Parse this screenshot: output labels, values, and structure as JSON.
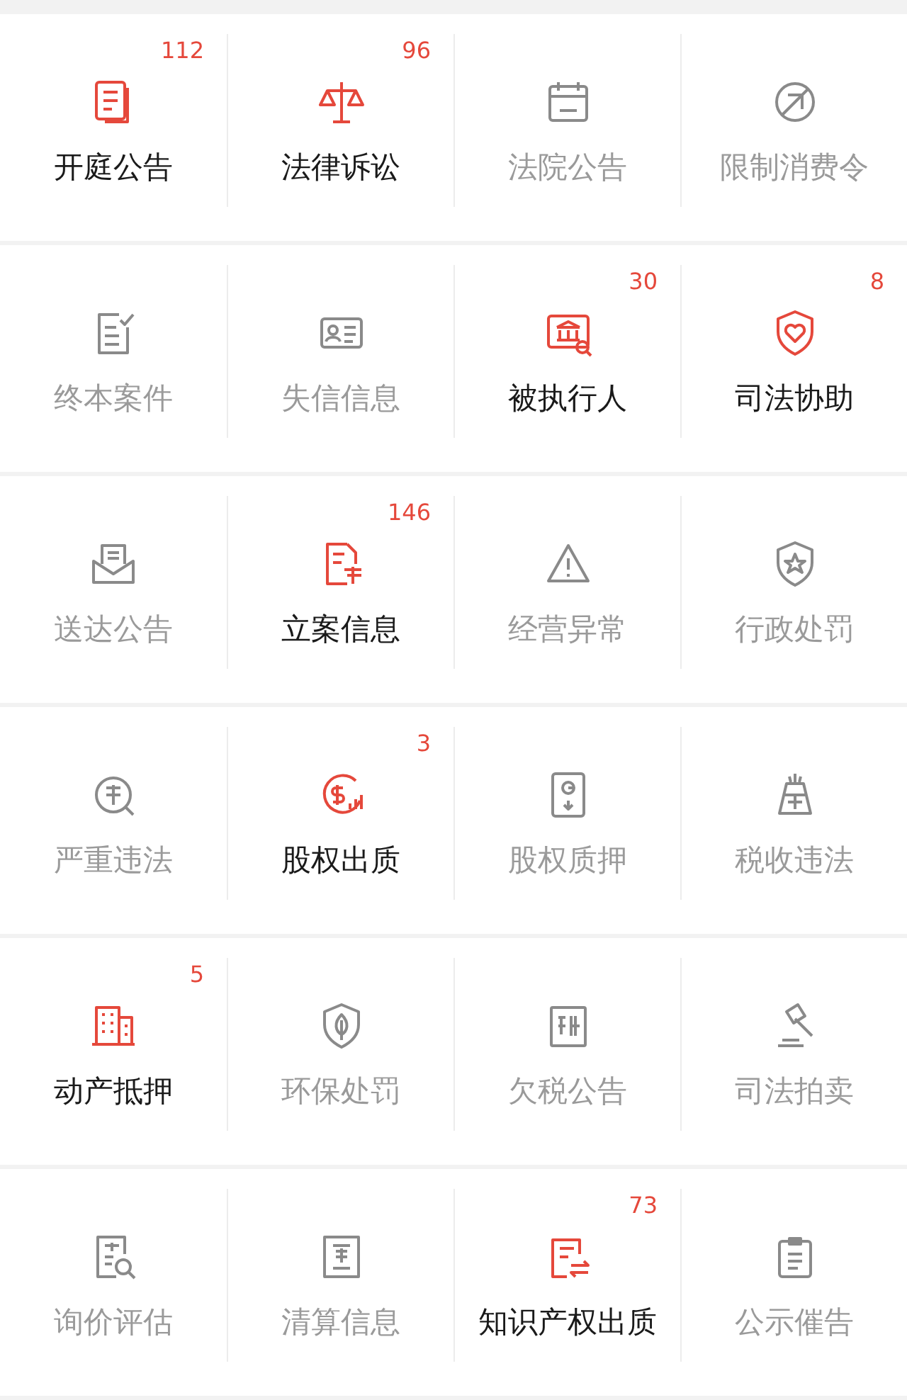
{
  "grid": [
    {
      "label": "开庭公告",
      "count": "112",
      "active": true
    },
    {
      "label": "法律诉讼",
      "count": "96",
      "active": true
    },
    {
      "label": "法院公告",
      "active": false
    },
    {
      "label": "限制消费令",
      "active": false
    },
    {
      "label": "终本案件",
      "active": false
    },
    {
      "label": "失信信息",
      "active": false
    },
    {
      "label": "被执行人",
      "count": "30",
      "active": true
    },
    {
      "label": "司法协助",
      "count": "8",
      "active": true
    },
    {
      "label": "送达公告",
      "active": false
    },
    {
      "label": "立案信息",
      "count": "146",
      "active": true
    },
    {
      "label": "经营异常",
      "active": false
    },
    {
      "label": "行政处罚",
      "active": false
    },
    {
      "label": "严重违法",
      "active": false
    },
    {
      "label": "股权出质",
      "count": "3",
      "active": true
    },
    {
      "label": "股权质押",
      "active": false
    },
    {
      "label": "税收违法",
      "active": false
    },
    {
      "label": "动产抵押",
      "count": "5",
      "active": true
    },
    {
      "label": "环保处罚",
      "active": false
    },
    {
      "label": "欠税公告",
      "active": false
    },
    {
      "label": "司法拍卖",
      "active": false
    },
    {
      "label": "询价评估",
      "active": false
    },
    {
      "label": "清算信息",
      "active": false
    },
    {
      "label": "知识产权出质",
      "count": "73",
      "active": true
    },
    {
      "label": "公示催告",
      "active": false
    }
  ]
}
